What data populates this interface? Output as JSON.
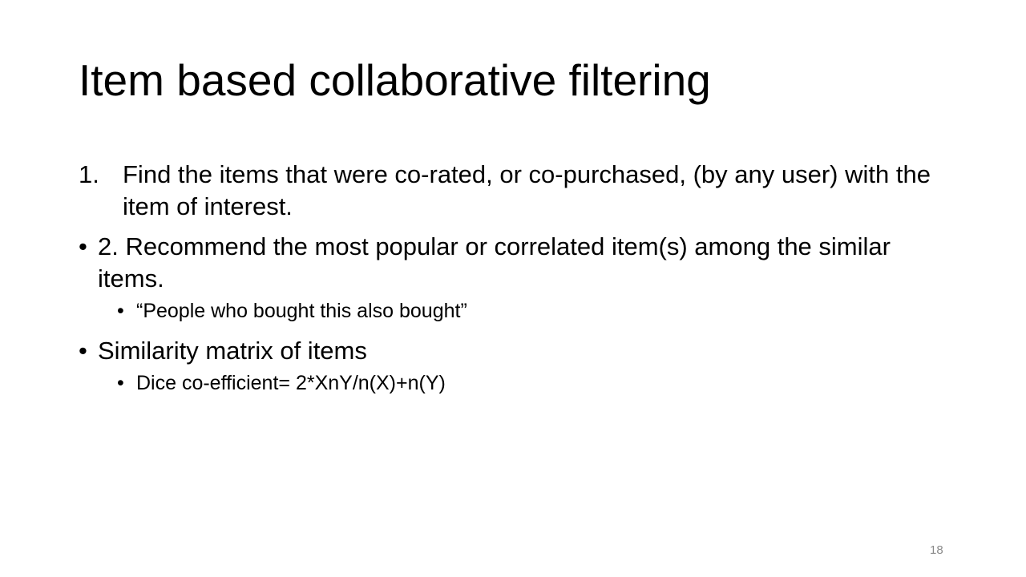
{
  "slide": {
    "title": "Item based collaborative filtering",
    "items": [
      {
        "marker": "1.",
        "text": "Find the items that were co-rated, or co-purchased, (by any user) with the item of interest."
      },
      {
        "marker": "•",
        "text": "2. Recommend the most popular or correlated item(s) among the similar items."
      },
      {
        "marker": "•",
        "text": "“People who bought this also bought”"
      },
      {
        "marker": "•",
        "text": "Similarity matrix of items"
      },
      {
        "marker": "•",
        "text": "Dice co-efficient= 2*XnY/n(X)+n(Y)"
      }
    ],
    "page_number": "18"
  }
}
